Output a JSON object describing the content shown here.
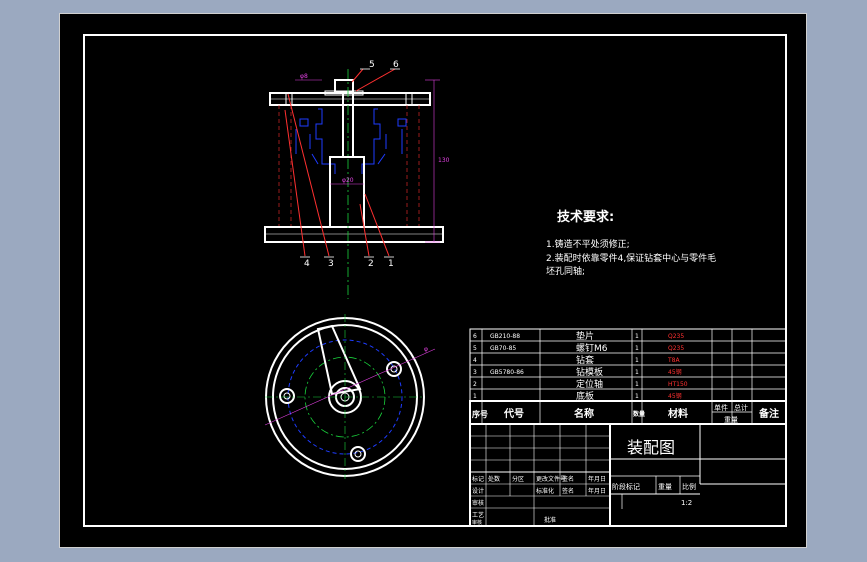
{
  "tech_requirements": {
    "title": "技术要求:",
    "line1": "1.铸造不平处须修正;",
    "line2": "2.装配时依靠零件4,保证钻套中心与零件毛",
    "line3": "坯孔同轴;"
  },
  "balloons": [
    "5",
    "6",
    "4",
    "3",
    "2",
    "1"
  ],
  "bom": {
    "rows": [
      {
        "no": "6",
        "code": "GB210-88",
        "name": "垫片",
        "qty": "1",
        "mat": "Q235"
      },
      {
        "no": "5",
        "code": "GB70-85",
        "name": "螺钉M6",
        "qty": "1",
        "mat": "Q235"
      },
      {
        "no": "4",
        "code": "",
        "name": "钻套",
        "qty": "1",
        "mat": "T8A"
      },
      {
        "no": "3",
        "code": "GB5780-86",
        "name": "钻模板",
        "qty": "1",
        "mat": "45钢"
      },
      {
        "no": "2",
        "code": "",
        "name": "定位轴",
        "qty": "1",
        "mat": "HT150"
      },
      {
        "no": "1",
        "code": "",
        "name": "底板",
        "qty": "1",
        "mat": "45钢"
      }
    ],
    "headers": {
      "no": "序号",
      "code": "代号",
      "name": "名称",
      "qty": "数量",
      "mat": "材料",
      "unit": "单件",
      "total": "总计",
      "weight": "重量",
      "remark": "备注"
    }
  },
  "title_block": {
    "drawing_title": "装配图",
    "stage_label": "阶段标记",
    "weight_label": "重量",
    "scale_label": "比例",
    "scale_value": "1:2",
    "rev_row": [
      "标记",
      "处数",
      "分区",
      "更改文件号",
      "签名",
      "年月日"
    ],
    "design_row": [
      "设计",
      "",
      "标准化",
      "",
      "签名",
      "年月日"
    ],
    "review": "审核",
    "process": "工艺",
    "approve": "批准",
    "check": "审核"
  }
}
